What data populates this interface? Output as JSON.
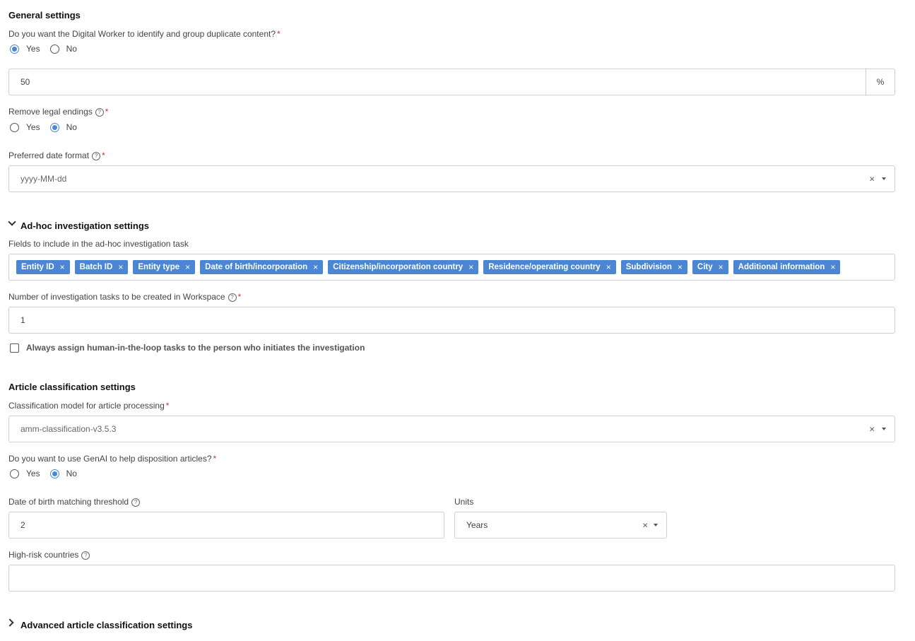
{
  "general": {
    "title": "General settings",
    "duplicate_question": "Do you want the Digital Worker to identify and group duplicate content?",
    "duplicate_options": [
      "Yes",
      "No"
    ],
    "duplicate_selected": "Yes",
    "threshold_value": "50",
    "threshold_suffix": "%",
    "legal_endings_label": "Remove legal endings",
    "legal_endings_options": [
      "Yes",
      "No"
    ],
    "legal_endings_selected": "No",
    "date_format_label": "Preferred date format",
    "date_format_value": "yyyy-MM-dd"
  },
  "adhoc": {
    "title": "Ad-hoc investigation settings",
    "fields_label": "Fields to include in the ad-hoc investigation task",
    "fields": [
      "Entity ID",
      "Batch ID",
      "Entity type",
      "Date of birth/incorporation",
      "Citizenship/incorporation country",
      "Residence/operating country",
      "Subdivision",
      "City",
      "Additional information"
    ],
    "tasks_label": "Number of investigation tasks to be created in Workspace",
    "tasks_value": "1",
    "assign_label": "Always assign human-in-the-loop tasks to the person who initiates the investigation"
  },
  "article": {
    "title": "Article classification settings",
    "model_label": "Classification model for article processing",
    "model_value": "amm-classification-v3.5.3",
    "genai_question": "Do you want to use GenAI to help disposition articles?",
    "genai_options": [
      "Yes",
      "No"
    ],
    "genai_selected": "No",
    "dob_label": "Date of birth matching threshold",
    "dob_value": "2",
    "units_label": "Units",
    "units_value": "Years",
    "high_risk_label": "High-risk countries",
    "high_risk_value": ""
  },
  "advanced": {
    "title": "Advanced article classification settings"
  },
  "common": {
    "required_mark": "*",
    "help_glyph": "?",
    "clear_glyph": "×",
    "chip_remove_glyph": "×"
  },
  "colors": {
    "accent": "#4a86d4",
    "required": "#c0392b"
  }
}
